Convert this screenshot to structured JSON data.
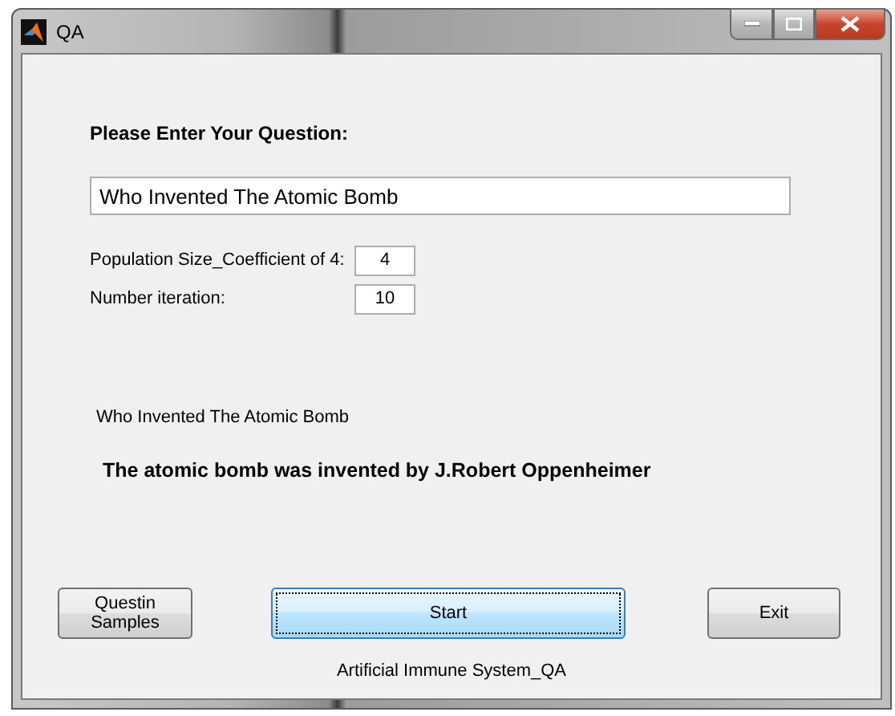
{
  "window": {
    "title": "QA"
  },
  "question_label": "Please Enter Your Question:",
  "question_field": {
    "value": "Who Invented The Atomic Bomb"
  },
  "parameters": [
    {
      "label": "Population Size_Coefficient of 4:",
      "value": "4"
    },
    {
      "label": "Number iteration:",
      "value": "10"
    }
  ],
  "echoed_question": "Who Invented The Atomic Bomb",
  "answer": "The atomic bomb was invented by J.Robert Oppenheimer",
  "buttons": [
    {
      "label": "Questin Samples",
      "focused": false
    },
    {
      "label": "Start",
      "focused": true
    },
    {
      "label": "Exit",
      "focused": false
    }
  ],
  "footer": "Artificial Immune System_QA"
}
